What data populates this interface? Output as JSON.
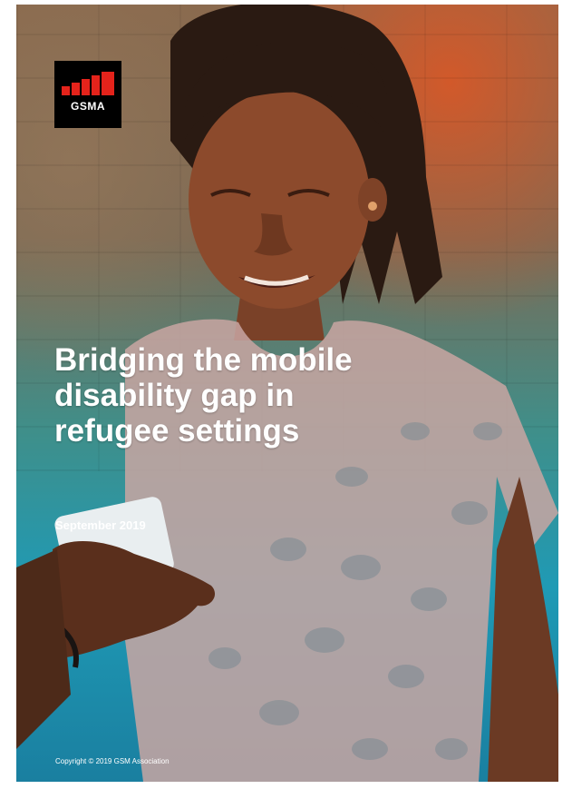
{
  "cover": {
    "logo_text": "GSMA",
    "title": "Bridging the mobile disability gap in refugee settings",
    "date": "September 2019",
    "copyright": "Copyright © 2019 GSM Association"
  },
  "colors": {
    "logo_red": "#e4231b",
    "orange": "#d6582a",
    "teal": "#1f9ab5"
  }
}
